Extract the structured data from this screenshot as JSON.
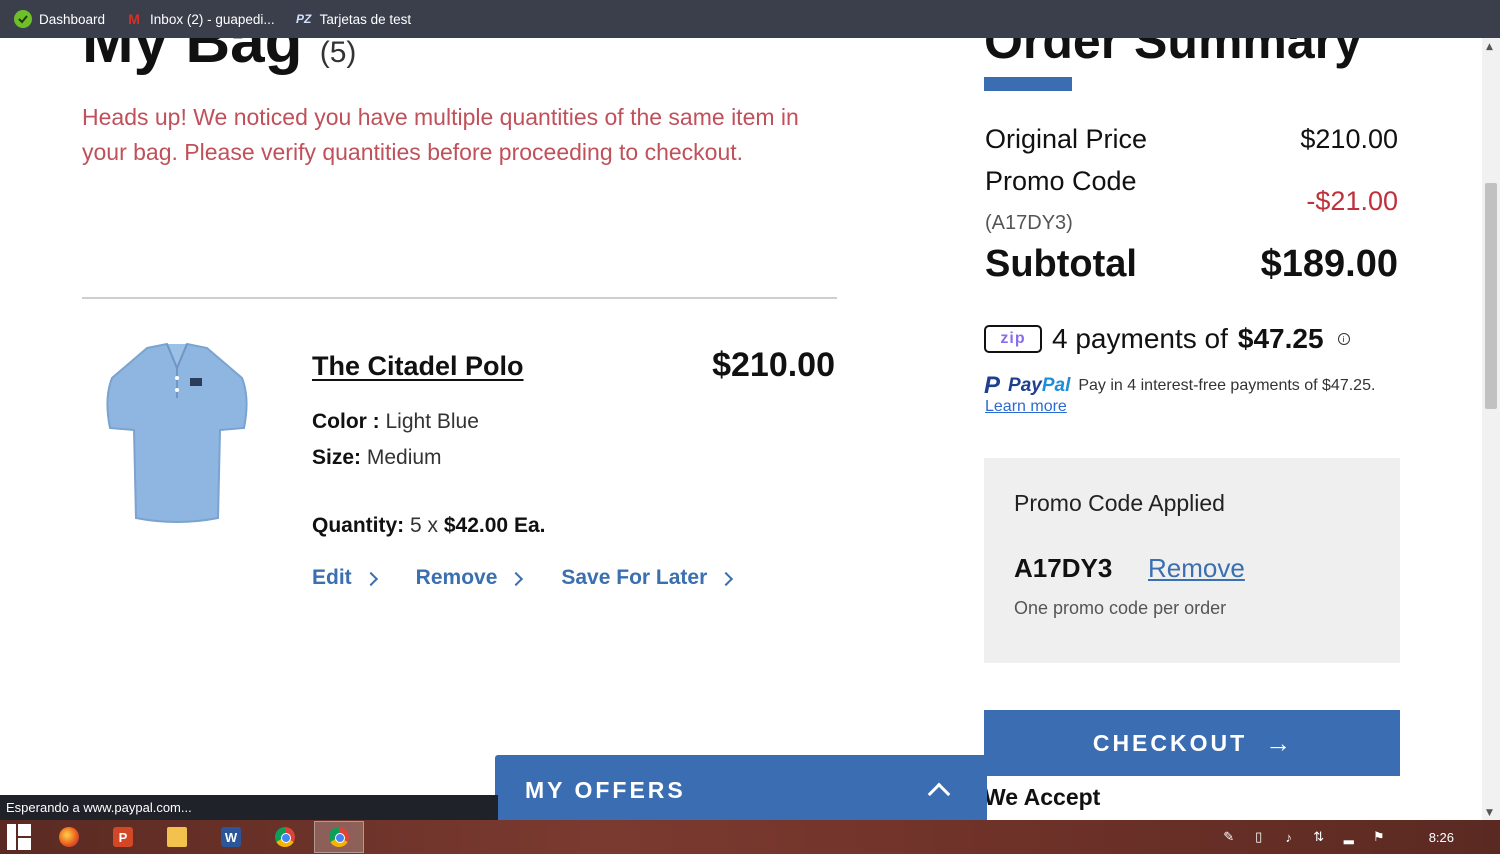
{
  "bookmarks": [
    {
      "label": "Dashboard",
      "icon": "dashboard-icon"
    },
    {
      "label": "Inbox (2) - guapedi...",
      "icon": "gmail-icon"
    },
    {
      "label": "Tarjetas de test",
      "icon": "pz-icon"
    }
  ],
  "bag": {
    "title": "My Bag",
    "count": "(5)",
    "notice": "Heads up! We noticed you have multiple quantities of the same item in your bag. Please verify quantities before proceeding to checkout."
  },
  "item": {
    "name": "The Citadel Polo",
    "price": "$210.00",
    "color_label": "Color :",
    "color_value": "Light Blue",
    "size_label": "Size:",
    "size_value": "Medium",
    "quantity_label": "Quantity:",
    "quantity_count": "5 x",
    "unit_price": "$42.00 Ea.",
    "actions": {
      "edit": "Edit",
      "remove": "Remove",
      "save_for_later": "Save For Later"
    },
    "image_color": "#8fb6e0"
  },
  "summary": {
    "title": "Order Summary",
    "original_price_label": "Original Price",
    "original_price": "$210.00",
    "promo_label": "Promo Code",
    "promo_code": "(A17DY3)",
    "promo_discount": "-$21.00",
    "subtotal_label": "Subtotal",
    "subtotal": "$189.00",
    "zip_logo": "zip",
    "zip_text": "4 payments of",
    "zip_amount": "$47.25",
    "paypal_p": "P",
    "paypal_pay": "Pay",
    "paypal_pal": "Pal",
    "paypal_text": "Pay in 4 interest-free payments of $47.25.",
    "paypal_learn_more": "Learn more"
  },
  "promo_box": {
    "title": "Promo Code Applied",
    "code": "A17DY3",
    "remove": "Remove",
    "note": "One promo code per order"
  },
  "checkout": {
    "label": "CHECKOUT",
    "arrow": "→"
  },
  "we_accept": "We Accept",
  "offers": {
    "label": "MY OFFERS"
  },
  "status_text": "Esperando a www.paypal.com...",
  "taskbar": {
    "apps": [
      {
        "icon": "firefox-icon"
      },
      {
        "icon": "powerpoint-icon",
        "glyph": "P",
        "color": "#d24726"
      },
      {
        "icon": "file-explorer-icon"
      },
      {
        "icon": "word-icon",
        "glyph": "W",
        "color": "#2b579a"
      },
      {
        "icon": "chrome-icon"
      },
      {
        "icon": "chrome-icon",
        "active": true
      }
    ],
    "clock": "8:26"
  },
  "colors": {
    "accent": "#3b6db3",
    "notice_red": "#c0505a",
    "discount_red": "#c0303a",
    "link_blue": "#3a6fb0"
  }
}
